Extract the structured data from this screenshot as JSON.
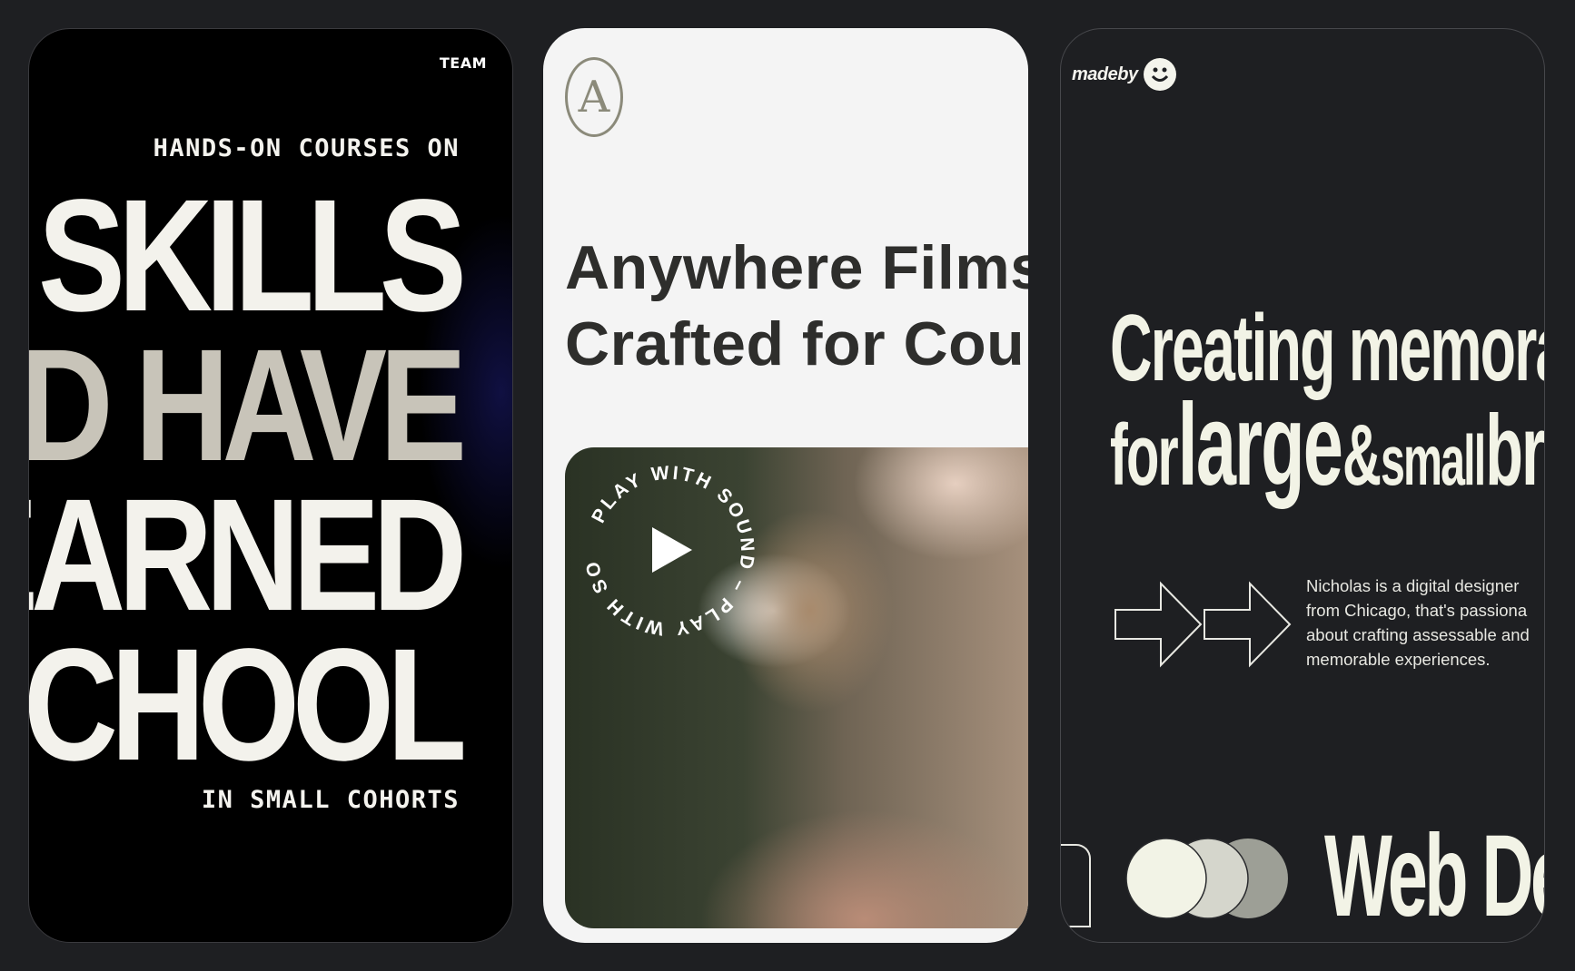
{
  "phone1": {
    "nav_label": "TEAM",
    "top_line": "HANDS-ON COURSES ON",
    "big_lines": [
      "SKILLS",
      "D HAVE",
      "EARNED",
      "SCHOOL"
    ],
    "bottom_line": "IN SMALL COHORTS"
  },
  "phone2": {
    "logo_letter": "A",
    "title_lines": [
      "Anywhere Films",
      "Crafted for Cou"
    ],
    "play_ring_text": "PLAY WITH SOUND – PLAY WITH SOUND – "
  },
  "phone3": {
    "brand": "madeby",
    "headline_line1": "Creating memorab",
    "headline_line2": {
      "w1": "for",
      "w2": "large",
      "w3": "&",
      "w4": "small",
      "w5": "bra"
    },
    "description_lines": [
      "Nicholas is a digital designer",
      "from Chicago, that's passiona",
      "about crafting assessable and",
      "memorable experiences."
    ],
    "bottom_text": "Web De"
  },
  "colors": {
    "page_bg": "#1e1f22",
    "cream": "#f3f2ec",
    "title_dark": "#2e2e2c"
  }
}
